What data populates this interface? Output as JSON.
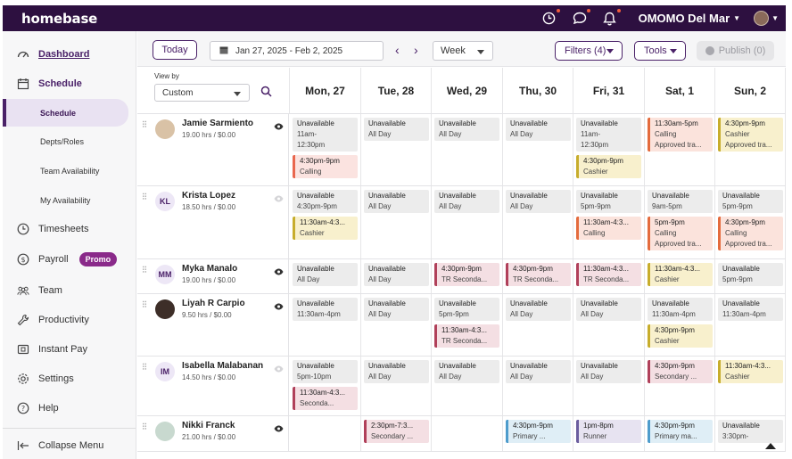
{
  "topbar": {
    "logo": "homebase",
    "org": "OMOMO Del Mar"
  },
  "sidebar": {
    "items": [
      {
        "label": "Dashboard"
      },
      {
        "label": "Schedule"
      },
      {
        "label": "Schedule"
      },
      {
        "label": "Depts/Roles"
      },
      {
        "label": "Team Availability"
      },
      {
        "label": "My Availability"
      },
      {
        "label": "Timesheets"
      },
      {
        "label": "Payroll",
        "badge": "Promo"
      },
      {
        "label": "Team"
      },
      {
        "label": "Productivity"
      },
      {
        "label": "Instant Pay"
      },
      {
        "label": "Settings"
      },
      {
        "label": "Help"
      },
      {
        "label": "Collapse Menu"
      }
    ]
  },
  "toolbar": {
    "today": "Today",
    "date_range": "Jan 27, 2025 - Feb 2, 2025",
    "view": "Week",
    "filters": "Filters (4)",
    "tools": "Tools",
    "publish": "Publish (0)"
  },
  "view_by": {
    "label": "View by",
    "value": "Custom"
  },
  "days": [
    "Mon, 27",
    "Tue, 28",
    "Wed, 29",
    "Thu, 30",
    "Fri, 31",
    "Sat, 1",
    "Sun, 2"
  ],
  "employees": [
    {
      "name": "Jamie Sarmiento",
      "hours": "19.00 hrs / $0.00",
      "initials": ""
    },
    {
      "name": "Krista Lopez",
      "hours": "18.50 hrs / $0.00",
      "initials": "KL"
    },
    {
      "name": "Myka Manalo",
      "hours": "19.00 hrs / $0.00",
      "initials": "MM"
    },
    {
      "name": "Liyah R Carpio",
      "hours": "9.50 hrs / $0.00",
      "initials": ""
    },
    {
      "name": "Isabella Malabanan",
      "hours": "14.50 hrs / $0.00",
      "initials": "IM"
    },
    {
      "name": "Nikki Franck",
      "hours": "21.00 hrs / $0.00",
      "initials": ""
    }
  ],
  "shifts": {
    "r0": [
      [
        {
          "c": "gray",
          "t": "Unavailable",
          "l": [
            "11am-",
            "12:30pm"
          ]
        },
        {
          "c": "pink",
          "t": "4:30pm-9pm",
          "l": [
            "Calling"
          ]
        }
      ],
      [
        {
          "c": "gray",
          "t": "Unavailable",
          "l": [
            "All Day"
          ]
        }
      ],
      [
        {
          "c": "gray",
          "t": "Unavailable",
          "l": [
            "All Day"
          ]
        }
      ],
      [
        {
          "c": "gray",
          "t": "Unavailable",
          "l": [
            "All Day"
          ]
        }
      ],
      [
        {
          "c": "gray",
          "t": "Unavailable",
          "l": [
            "11am-",
            "12:30pm"
          ]
        },
        {
          "c": "yellow",
          "t": "4:30pm-9pm",
          "l": [
            "Cashier"
          ]
        }
      ],
      [
        {
          "c": "orange",
          "t": "11:30am-5pm",
          "l": [
            "Calling",
            "Approved tra..."
          ]
        }
      ],
      [
        {
          "c": "yellow",
          "t": "4:30pm-9pm",
          "l": [
            "Cashier",
            "Approved tra..."
          ]
        }
      ]
    ],
    "r1": [
      [
        {
          "c": "gray",
          "t": "Unavailable",
          "l": [
            "4:30pm-9pm"
          ]
        },
        {
          "c": "yellow",
          "t": "11:30am-4:3...",
          "l": [
            "Cashier"
          ]
        }
      ],
      [
        {
          "c": "gray",
          "t": "Unavailable",
          "l": [
            "All Day"
          ]
        }
      ],
      [
        {
          "c": "gray",
          "t": "Unavailable",
          "l": [
            "All Day"
          ]
        }
      ],
      [
        {
          "c": "gray",
          "t": "Unavailable",
          "l": [
            "All Day"
          ]
        }
      ],
      [
        {
          "c": "gray",
          "t": "Unavailable",
          "l": [
            "5pm-9pm"
          ]
        },
        {
          "c": "orange",
          "t": "11:30am-4:3...",
          "l": [
            "Calling"
          ]
        }
      ],
      [
        {
          "c": "gray",
          "t": "Unavailable",
          "l": [
            "9am-5pm"
          ]
        },
        {
          "c": "orange",
          "t": "5pm-9pm",
          "l": [
            "Calling",
            "Approved tra..."
          ]
        }
      ],
      [
        {
          "c": "gray",
          "t": "Unavailable",
          "l": [
            "5pm-9pm"
          ]
        },
        {
          "c": "orange",
          "t": "4:30pm-9pm",
          "l": [
            "Calling",
            "Approved tra..."
          ]
        }
      ]
    ],
    "r2": [
      [
        {
          "c": "gray",
          "t": "Unavailable",
          "l": [
            "All Day"
          ]
        }
      ],
      [
        {
          "c": "gray",
          "t": "Unavailable",
          "l": [
            "All Day"
          ]
        }
      ],
      [
        {
          "c": "rose",
          "t": "4:30pm-9pm",
          "l": [
            "TR Seconda..."
          ]
        }
      ],
      [
        {
          "c": "rose",
          "t": "4:30pm-9pm",
          "l": [
            "TR Seconda..."
          ]
        }
      ],
      [
        {
          "c": "rose",
          "t": "11:30am-4:3...",
          "l": [
            "TR Seconda..."
          ]
        }
      ],
      [
        {
          "c": "yellow",
          "t": "11:30am-4:3...",
          "l": [
            "Cashier"
          ]
        }
      ],
      [
        {
          "c": "gray",
          "t": "Unavailable",
          "l": [
            "5pm-9pm"
          ]
        }
      ]
    ],
    "r3": [
      [
        {
          "c": "gray",
          "t": "Unavailable",
          "l": [
            "11:30am-4pm"
          ]
        }
      ],
      [
        {
          "c": "gray",
          "t": "Unavailable",
          "l": [
            "All Day"
          ]
        }
      ],
      [
        {
          "c": "gray",
          "t": "Unavailable",
          "l": [
            "5pm-9pm"
          ]
        },
        {
          "c": "rose",
          "t": "11:30am-4:3...",
          "l": [
            "TR Seconda..."
          ]
        }
      ],
      [
        {
          "c": "gray",
          "t": "Unavailable",
          "l": [
            "All Day"
          ]
        }
      ],
      [
        {
          "c": "gray",
          "t": "Unavailable",
          "l": [
            "All Day"
          ]
        }
      ],
      [
        {
          "c": "gray",
          "t": "Unavailable",
          "l": [
            "11:30am-4pm"
          ]
        },
        {
          "c": "yellow",
          "t": "4:30pm-9pm",
          "l": [
            "Cashier"
          ]
        }
      ],
      [
        {
          "c": "gray",
          "t": "Unavailable",
          "l": [
            "11:30am-4pm"
          ]
        }
      ]
    ],
    "r4": [
      [
        {
          "c": "gray",
          "t": "Unavailable",
          "l": [
            "5pm-10pm"
          ]
        },
        {
          "c": "rose",
          "t": "11:30am-4:3...",
          "l": [
            "Seconda..."
          ]
        }
      ],
      [
        {
          "c": "gray",
          "t": "Unavailable",
          "l": [
            "All Day"
          ]
        }
      ],
      [
        {
          "c": "gray",
          "t": "Unavailable",
          "l": [
            "All Day"
          ]
        }
      ],
      [
        {
          "c": "gray",
          "t": "Unavailable",
          "l": [
            "All Day"
          ]
        }
      ],
      [
        {
          "c": "gray",
          "t": "Unavailable",
          "l": [
            "All Day"
          ]
        }
      ],
      [
        {
          "c": "rose",
          "t": "4:30pm-9pm",
          "l": [
            "Secondary ..."
          ]
        }
      ],
      [
        {
          "c": "yellow",
          "t": "11:30am-4:3...",
          "l": [
            "Cashier"
          ]
        }
      ]
    ],
    "r5": [
      [],
      [
        {
          "c": "rose",
          "t": "2:30pm-7:3...",
          "l": [
            "Secondary ..."
          ]
        }
      ],
      [],
      [
        {
          "c": "blue",
          "t": "4:30pm-9pm",
          "l": [
            "Primary ..."
          ]
        }
      ],
      [
        {
          "c": "purple",
          "t": "1pm-8pm",
          "l": [
            "Runner"
          ]
        }
      ],
      [
        {
          "c": "blue",
          "t": "4:30pm-9pm",
          "l": [
            "Primary ma..."
          ]
        }
      ],
      [
        {
          "c": "gray",
          "t": "Unavailable",
          "l": [
            "3:30pm-"
          ]
        }
      ]
    ]
  }
}
